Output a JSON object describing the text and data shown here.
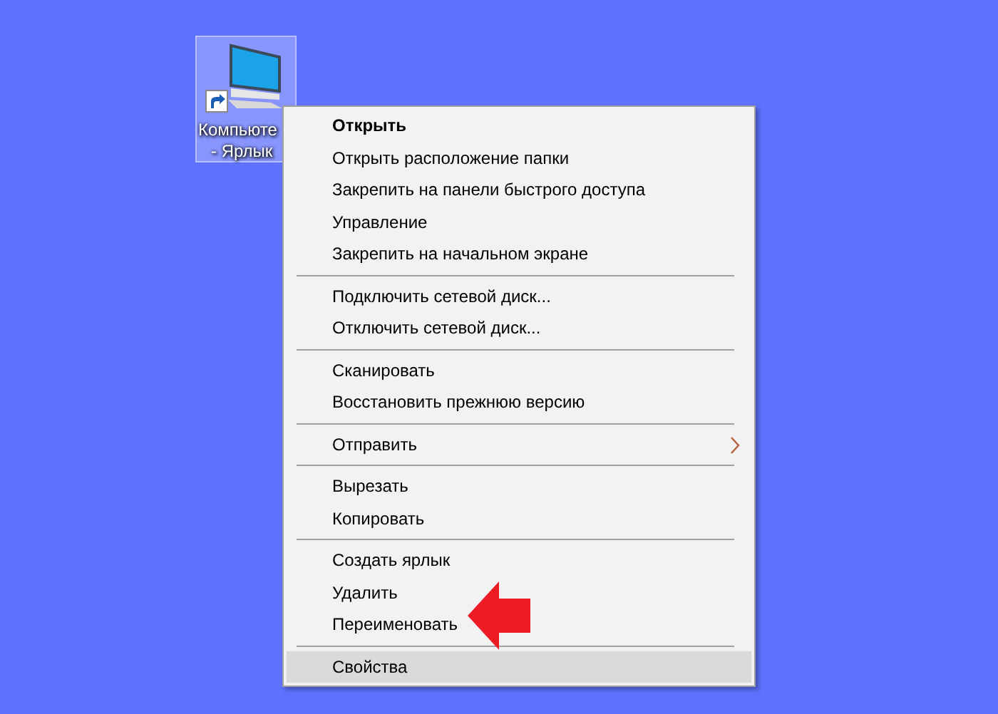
{
  "desktop_icon": {
    "label_lines": [
      "Компьюте",
      "- Ярлык"
    ],
    "selected": true
  },
  "context_menu": {
    "groups": [
      {
        "items": [
          {
            "label": "Открыть",
            "default": true,
            "submenu": false,
            "selected": false
          },
          {
            "label": "Открыть расположение папки",
            "default": false,
            "submenu": false,
            "selected": false
          },
          {
            "label": "Закрепить на панели быстрого доступа",
            "default": false,
            "submenu": false,
            "selected": false
          },
          {
            "label": "Управление",
            "default": false,
            "submenu": false,
            "selected": false
          },
          {
            "label": "Закрепить на начальном экране",
            "default": false,
            "submenu": false,
            "selected": false
          }
        ]
      },
      {
        "items": [
          {
            "label": "Подключить сетевой диск...",
            "default": false,
            "submenu": false,
            "selected": false
          },
          {
            "label": "Отключить сетевой диск...",
            "default": false,
            "submenu": false,
            "selected": false
          }
        ]
      },
      {
        "items": [
          {
            "label": "Сканировать",
            "default": false,
            "submenu": false,
            "selected": false
          },
          {
            "label": "Восстановить прежнюю версию",
            "default": false,
            "submenu": false,
            "selected": false
          }
        ]
      },
      {
        "items": [
          {
            "label": "Отправить",
            "default": false,
            "submenu": true,
            "selected": false
          }
        ]
      },
      {
        "items": [
          {
            "label": "Вырезать",
            "default": false,
            "submenu": false,
            "selected": false
          },
          {
            "label": "Копировать",
            "default": false,
            "submenu": false,
            "selected": false
          }
        ]
      },
      {
        "items": [
          {
            "label": "Создать ярлык",
            "default": false,
            "submenu": false,
            "selected": false
          },
          {
            "label": "Удалить",
            "default": false,
            "submenu": false,
            "selected": false
          },
          {
            "label": "Переименовать",
            "default": false,
            "submenu": false,
            "selected": false
          }
        ]
      },
      {
        "items": [
          {
            "label": "Свойства",
            "default": false,
            "submenu": false,
            "selected": true
          }
        ]
      }
    ]
  }
}
